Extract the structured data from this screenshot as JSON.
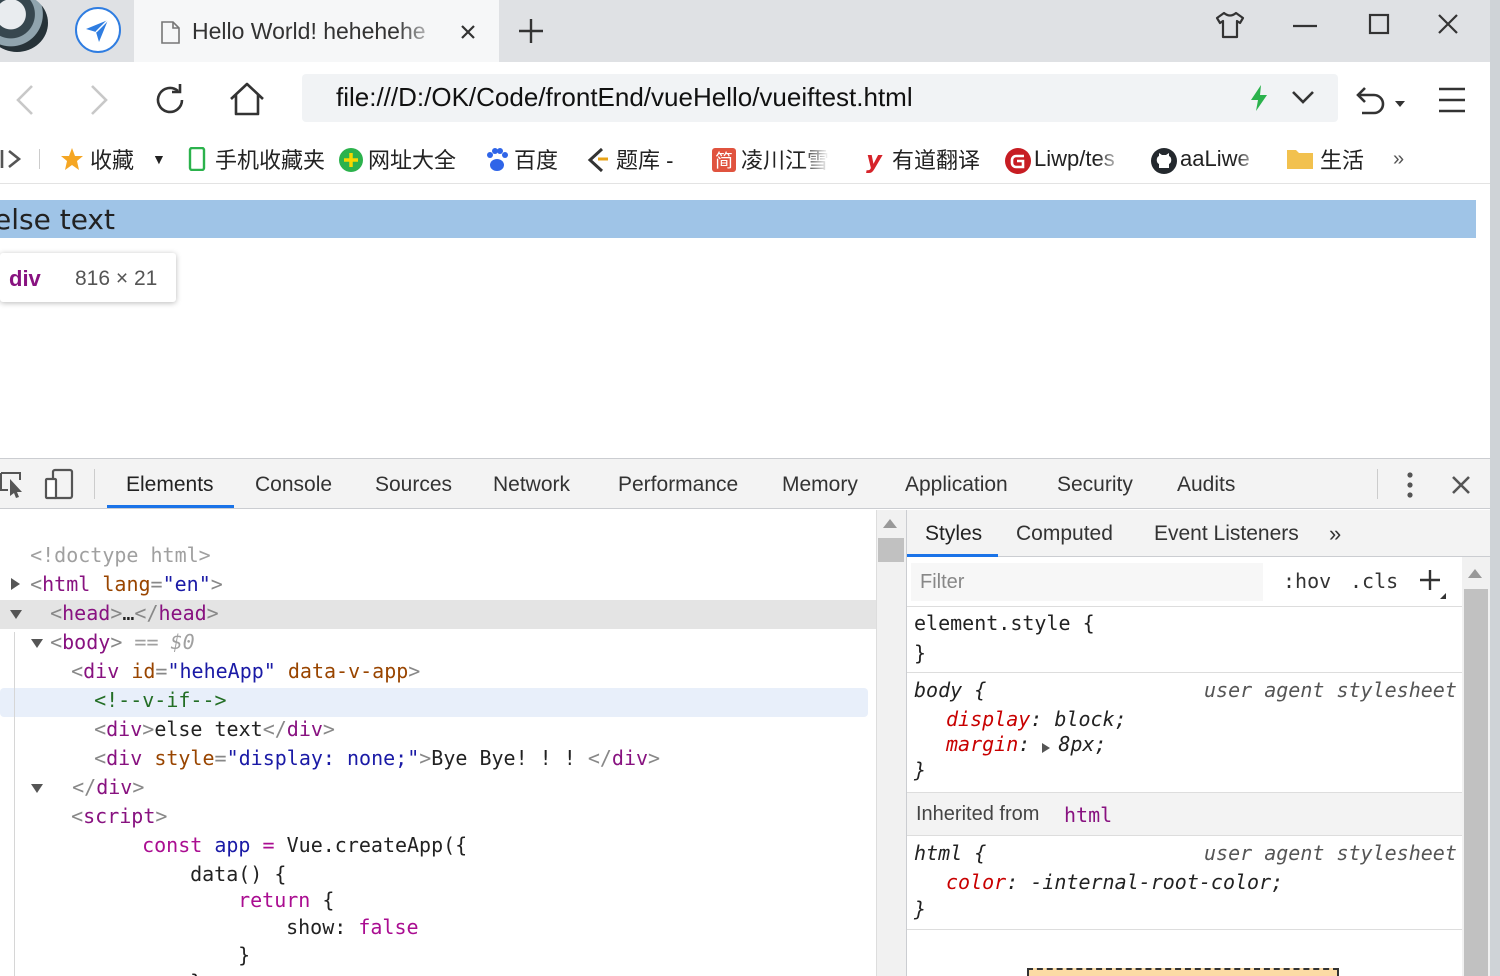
{
  "window": {
    "tab_title": "Hello World! hehehehe",
    "url": "file:///D:/OK/Code/frontEnd/vueHello/vueiftest.html"
  },
  "bookmarks": [
    {
      "label": "收藏",
      "icon": "star-icon",
      "color": "#f5a623"
    },
    {
      "label": "手机收藏夹",
      "icon": "phone-icon",
      "color": "#2bb24c"
    },
    {
      "label": "网址大全",
      "icon": "plus-circle-icon",
      "color": "#2bb24c"
    },
    {
      "label": "百度",
      "icon": "baidu-paw-icon",
      "color": "#2f65e8"
    },
    {
      "label": "题库 -",
      "icon": "quiz-icon",
      "color": "#333333"
    },
    {
      "label": "凌川江雪",
      "icon": "csdn-jian-icon",
      "color": "#e0533f"
    },
    {
      "label": "有道翻译",
      "icon": "youdao-icon",
      "color": "#d6232a"
    },
    {
      "label": "Liwp/tes",
      "icon": "gitee-icon",
      "color": "#c71d23"
    },
    {
      "label": "aaLiwe",
      "icon": "github-icon",
      "color": "#24292e"
    },
    {
      "label": "生活",
      "icon": "folder-icon",
      "color": "#f2c14e"
    }
  ],
  "bookmarks_more": "»",
  "page": {
    "text": "else text",
    "tooltip_tag": "div",
    "tooltip_size": "816 × 21"
  },
  "devtools": {
    "tabs": [
      "Elements",
      "Console",
      "Sources",
      "Network",
      "Performance",
      "Memory",
      "Application",
      "Security",
      "Audits"
    ],
    "active_tab": "Elements",
    "dom": {
      "doctype": "<!doctype html>",
      "html_open": "<html",
      "html_attr": "lang",
      "html_val": "\"en\"",
      "head": "<head>…</head>",
      "body_open": "<body>",
      "body_marker": " == $0",
      "div_app_open": "<div",
      "div_app_attr1": "id",
      "div_app_val1": "\"heheApp\"",
      "div_app_attr2": "data-v-app",
      "comment": "<!--v-if-->",
      "div_else_open": "<div>",
      "div_else_text": "else text",
      "div_else_close": "</div>",
      "div_bye_open": "<div",
      "div_bye_attr": "style",
      "div_bye_val": "\"display: none;\"",
      "div_bye_text": "Bye Bye! ! ! ",
      "div_bye_close": "</div>",
      "div_app_close": "</div>",
      "script_open": "<script>",
      "code": [
        {
          "kw": "const",
          "rest1": " app",
          "op": " = ",
          "rest2": "Vue.createApp({"
        },
        {
          "plain": "data() {"
        },
        {
          "kw": "return",
          "rest1": " {"
        },
        {
          "plain": "show: ",
          "lit": "false"
        },
        {
          "plain": "}"
        },
        {
          "plain": "},"
        }
      ]
    },
    "styles": {
      "tabs": [
        "Styles",
        "Computed",
        "Event Listeners"
      ],
      "more": "»",
      "filter_placeholder": "Filter",
      "hov": ":hov",
      "cls": ".cls",
      "element_style": "element.style {",
      "close_brace": "}",
      "body_rule": {
        "selector": "body {",
        "source": "user agent stylesheet",
        "props": [
          {
            "name": "display",
            "value": "block;"
          },
          {
            "name": "margin",
            "value": "8px;"
          }
        ]
      },
      "inherited_label": "Inherited from",
      "inherited_tag": "html",
      "html_rule": {
        "selector": "html {",
        "source": "user agent stylesheet",
        "props": [
          {
            "name": "color",
            "value": "-internal-root-color;"
          }
        ]
      }
    }
  }
}
